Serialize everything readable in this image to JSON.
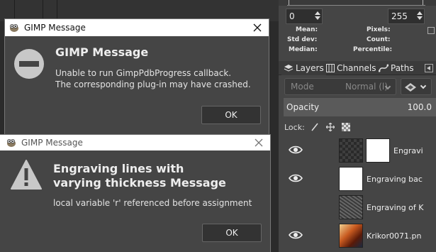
{
  "dock": {
    "levels": {
      "low": "0",
      "high": "255"
    },
    "stats": {
      "mean": "Mean:",
      "std_dev": "Std dev:",
      "median": "Median:",
      "pixels": "Pixels:",
      "count": "Count:",
      "percentile": "Percentile:"
    },
    "tabs": [
      {
        "label": "Layers",
        "icon": "layers-icon"
      },
      {
        "label": "Channels",
        "icon": "channels-icon"
      },
      {
        "label": "Paths",
        "icon": "paths-icon"
      }
    ],
    "mode": {
      "label": "Mode",
      "value": "Normal (l)"
    },
    "opacity": {
      "label": "Opacity",
      "value": "100.0"
    },
    "lock_label": "Lock:",
    "layers": [
      {
        "name": "Engravi",
        "visible": true,
        "thumb": "checker",
        "has_mask": true
      },
      {
        "name": "Engraving bac",
        "visible": true,
        "thumb": "white",
        "has_mask": false
      },
      {
        "name": "Engraving of K",
        "visible": false,
        "thumb": "texture",
        "has_mask": false
      },
      {
        "name": "Krikor0071.pn",
        "visible": true,
        "thumb": "portrait",
        "has_mask": false
      }
    ]
  },
  "dialog1": {
    "title": "GIMP Message",
    "heading": "GIMP Message",
    "message": "Unable to run GimpPdbProgress callback.\nThe corresponding plug-in may have crashed.",
    "ok": "OK",
    "icon": "no-entry-icon"
  },
  "dialog2": {
    "title": "GIMP Message",
    "heading_line1": "Engraving lines with",
    "heading_line2": "varying thickness Message",
    "message": "local variable 'r' referenced before assignment",
    "ok": "OK",
    "icon": "warning-icon"
  },
  "colors": {
    "dialog_bg": "#454545",
    "titlebar_bg": "#ffffff",
    "dock_bg": "#454545"
  }
}
